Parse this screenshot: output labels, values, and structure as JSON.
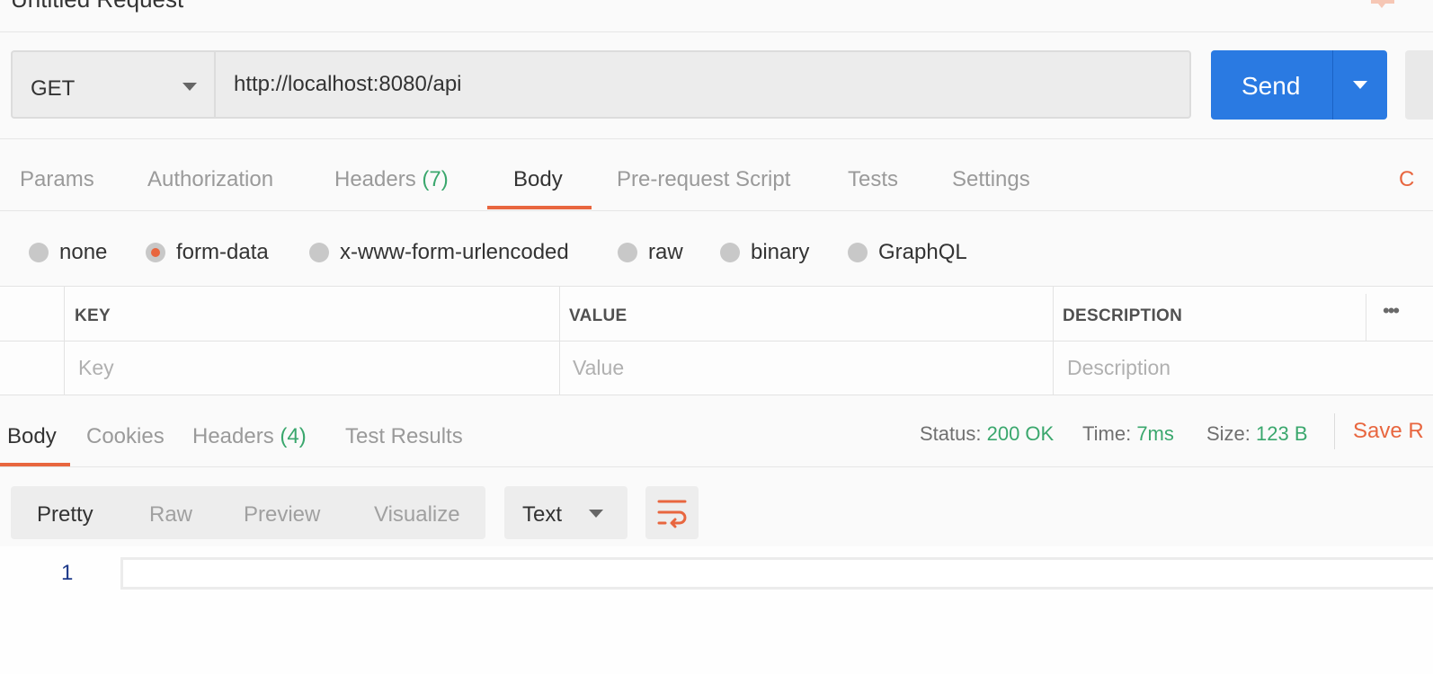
{
  "request": {
    "title": "Untitled Request",
    "method": "GET",
    "url": "http://localhost:8080/api",
    "send_label": "Send"
  },
  "request_tabs": [
    {
      "label": "Params"
    },
    {
      "label": "Authorization"
    },
    {
      "label": "Headers",
      "count": "(7)"
    },
    {
      "label": "Body",
      "active": true
    },
    {
      "label": "Pre-request Script"
    },
    {
      "label": "Tests"
    },
    {
      "label": "Settings"
    }
  ],
  "cookies_edge": "C",
  "body_types": [
    {
      "label": "none",
      "checked": false
    },
    {
      "label": "form-data",
      "checked": true
    },
    {
      "label": "x-www-form-urlencoded",
      "checked": false
    },
    {
      "label": "raw",
      "checked": false
    },
    {
      "label": "binary",
      "checked": false
    },
    {
      "label": "GraphQL",
      "checked": false
    }
  ],
  "kv_table": {
    "headers": {
      "key": "KEY",
      "value": "VALUE",
      "description": "DESCRIPTION"
    },
    "placeholders": {
      "key": "Key",
      "value": "Value",
      "description": "Description"
    },
    "more": "•••"
  },
  "response": {
    "tabs": [
      {
        "label": "Body",
        "active": true
      },
      {
        "label": "Cookies"
      },
      {
        "label": "Headers",
        "count": "(4)"
      },
      {
        "label": "Test Results"
      }
    ],
    "status_label": "Status:",
    "status_value": "200 OK",
    "time_label": "Time:",
    "time_value": "7ms",
    "size_label": "Size:",
    "size_value": "123 B",
    "save_label": "Save R",
    "format_modes": [
      {
        "label": "Pretty",
        "active": true
      },
      {
        "label": "Raw"
      },
      {
        "label": "Preview"
      },
      {
        "label": "Visualize"
      }
    ],
    "language": "Text",
    "line_numbers": [
      "1"
    ]
  },
  "colors": {
    "accent": "#e8663f",
    "send": "#2a7ae2",
    "success": "#3aa76d"
  },
  "icons": {
    "method_caret": "chevron-down-icon",
    "send_caret": "chevron-down-icon",
    "wrap": "wrap-lines-icon",
    "comments": "comment-icon"
  }
}
